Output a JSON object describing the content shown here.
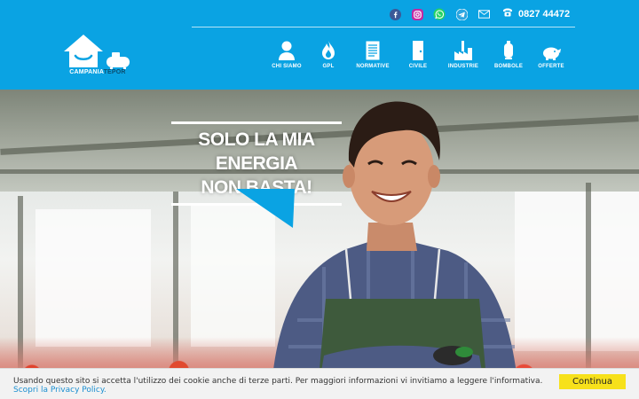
{
  "header": {
    "social": [
      {
        "icon": "facebook-icon"
      },
      {
        "icon": "instagram-icon"
      },
      {
        "icon": "whatsapp-icon"
      },
      {
        "icon": "telegram-icon"
      },
      {
        "icon": "email-icon"
      }
    ],
    "phone": "0827 44472",
    "logo": {
      "part1": "CAMPANIA",
      "part2": "TEPOR"
    },
    "nav": [
      {
        "label": "CHI SIAMO",
        "icon": "person-icon"
      },
      {
        "label": "GPL",
        "icon": "flame-icon"
      },
      {
        "label": "NORMATIVE",
        "icon": "document-icon"
      },
      {
        "label": "CIVILE",
        "icon": "door-icon"
      },
      {
        "label": "INDUSTRIE",
        "icon": "factory-icon"
      },
      {
        "label": "BOMBOLE",
        "icon": "gas-cylinder-icon"
      },
      {
        "label": "OFFERTE",
        "icon": "piggy-bank-icon"
      }
    ]
  },
  "hero": {
    "slogan_line1": "SOLO LA MIA ENERGIA",
    "slogan_line2": "NON BASTA!"
  },
  "cookie": {
    "text": "Usando questo sito si accetta l'utilizzo dei cookie anche di terze parti. Per maggiori informazioni vi invitiamo a leggere l'informativa.",
    "link": "Scopri la Privacy Policy.",
    "button": "Continua"
  },
  "colors": {
    "brand_blue": "#0aa3e3",
    "logo_dark": "#0b4e70",
    "cookie_button": "#f7e11b",
    "link": "#1b8fd1"
  }
}
